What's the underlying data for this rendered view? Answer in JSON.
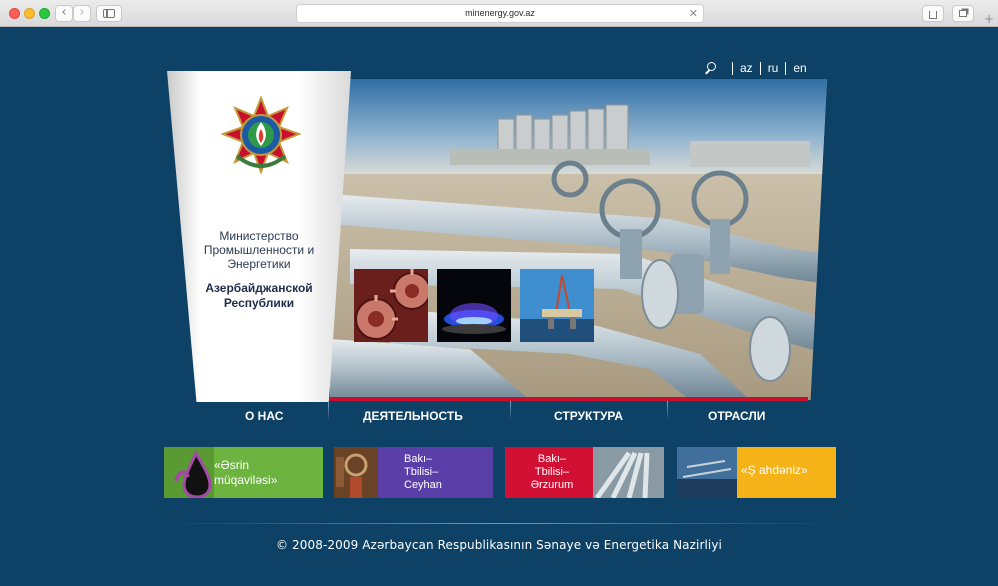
{
  "browser": {
    "url": "minenergy.gov.az",
    "back_glyph": "‹",
    "forward_glyph": "›",
    "clear_glyph": "✕",
    "new_tab_glyph": "+",
    "icons": [
      "back-icon",
      "forward-icon",
      "sidebar-icon",
      "share-icon",
      "tabs-icon",
      "close-icon",
      "plus-icon"
    ]
  },
  "header": {
    "languages": [
      "az",
      "ru",
      "en"
    ],
    "search_icon": "search-icon"
  },
  "logo": {
    "emblem_icon": "state-emblem-icon",
    "ministry_name": [
      "Министерство",
      "Промышленности и",
      "Энергетики"
    ],
    "republic_name": [
      "Азербайджанской",
      "Республики"
    ]
  },
  "hero": {
    "image": "pipeline-facility-photo",
    "thumbnails": [
      {
        "name": "gears-thumbnail"
      },
      {
        "name": "gas-flame-thumbnail"
      },
      {
        "name": "oil-platform-thumbnail"
      }
    ]
  },
  "nav": {
    "items": [
      "О НАС",
      "ДЕЯТЕЛЬНОСТЬ",
      "СТРУКТУРА",
      "ОТРАСЛИ"
    ]
  },
  "banners": [
    {
      "lines": [
        "«Əsrin",
        "müqaviləsi»"
      ],
      "color": "#6db33f"
    },
    {
      "lines": [
        "Bakı–",
        "Tbilisi–",
        "Ceyhan"
      ],
      "color": "#5b3fa8"
    },
    {
      "lines": [
        "Bakı–",
        "Tbilisi–",
        "Ərzurum"
      ],
      "color": "#d21034"
    },
    {
      "lines": [
        "«Ş ahdəniz»"
      ],
      "color": "#f6b318"
    }
  ],
  "footer": {
    "copyright": "© 2008-2009 Azərbaycan Respublikasının Sənaye və Energetika Nazirliyi"
  }
}
